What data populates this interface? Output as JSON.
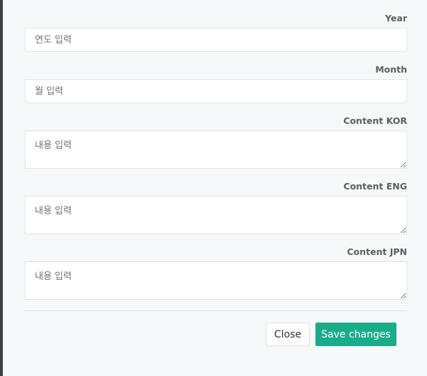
{
  "form": {
    "year": {
      "label": "Year",
      "placeholder": "연도 입력",
      "value": ""
    },
    "month": {
      "label": "Month",
      "placeholder": "월 입력",
      "value": ""
    },
    "content_kor": {
      "label": "Content KOR",
      "placeholder": "내용 입력",
      "value": ""
    },
    "content_eng": {
      "label": "Content ENG",
      "placeholder": "내용 입력",
      "value": ""
    },
    "content_jpn": {
      "label": "Content JPN",
      "placeholder": "내용 입력",
      "value": ""
    }
  },
  "footer": {
    "close_label": "Close",
    "save_label": "Save changes"
  },
  "colors": {
    "primary": "#1aab8a",
    "background": "#f7f8f9",
    "label": "#5b5f63",
    "border": "#e1e3e6"
  }
}
